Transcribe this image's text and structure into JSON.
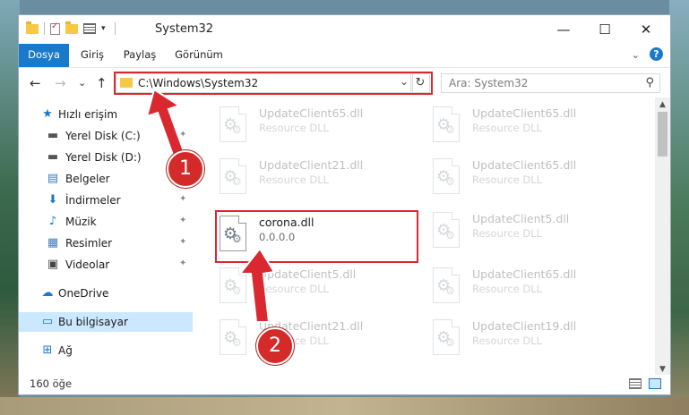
{
  "window": {
    "title": "System32",
    "min_glyph": "—",
    "max_glyph": "☐",
    "close_glyph": "✕"
  },
  "ribbon": {
    "tabs": [
      "Dosya",
      "Giriş",
      "Paylaş",
      "Görünüm"
    ],
    "expand_glyph": "⌄",
    "help_glyph": "?"
  },
  "nav": {
    "back_glyph": "←",
    "forward_glyph": "→",
    "recent_glyph": "⌄",
    "up_glyph": "↑",
    "address": "C:\\Windows\\System32",
    "address_drop_glyph": "⌄",
    "refresh_glyph": "↻",
    "search_placeholder": "Ara: System32",
    "search_glyph": "⚲"
  },
  "sidebar": {
    "items": [
      {
        "label": "Hızlı erişim",
        "icon": "star-icon",
        "glyph": "★",
        "color": "#1979ca"
      },
      {
        "label": "Yerel Disk (C:)",
        "icon": "drive-icon",
        "glyph": "▬",
        "color": "#555555"
      },
      {
        "label": "Yerel Disk (D:)",
        "icon": "drive-icon",
        "glyph": "▬",
        "color": "#555555"
      },
      {
        "label": "Belgeler",
        "icon": "document-icon",
        "glyph": "▤",
        "color": "#3d7ac2"
      },
      {
        "label": "İndirmeler",
        "icon": "download-icon",
        "glyph": "⬇",
        "color": "#1979ca"
      },
      {
        "label": "Müzik",
        "icon": "music-icon",
        "glyph": "♪",
        "color": "#1979ca"
      },
      {
        "label": "Resimler",
        "icon": "pictures-icon",
        "glyph": "▦",
        "color": "#3d7ac2"
      },
      {
        "label": "Videolar",
        "icon": "video-icon",
        "glyph": "▣",
        "color": "#444444"
      },
      {
        "label": "OneDrive",
        "icon": "cloud-icon",
        "glyph": "☁",
        "color": "#1979ca"
      },
      {
        "label": "Bu bilgisayar",
        "icon": "computer-icon",
        "glyph": "▭",
        "color": "#1979ca"
      },
      {
        "label": "Ağ",
        "icon": "network-icon",
        "glyph": "⊞",
        "color": "#1979ca"
      }
    ],
    "pin_glyph": "📌"
  },
  "files": [
    {
      "name": "UpdateClient65.dll",
      "sub": "Resource DLL"
    },
    {
      "name": "UpdateClient65.dll",
      "sub": "Resource DLL"
    },
    {
      "name": "UpdateClient21.dll",
      "sub": "Resource DLL"
    },
    {
      "name": "UpdateClient65.dll",
      "sub": "Resource DLL"
    },
    {
      "name": "corona.dll",
      "sub": "0.0.0.0",
      "sub2": "-"
    },
    {
      "name": "UpdateClient5.dll",
      "sub": "Resource DLL"
    },
    {
      "name": "UpdateClient5.dll",
      "sub": "Resource DLL"
    },
    {
      "name": "UpdateClient65.dll",
      "sub": "Resource DLL"
    },
    {
      "name": "UpdateClient21.dll",
      "sub": "Resource DLL"
    },
    {
      "name": "UpdateClient19.dll",
      "sub": "Resource DLL"
    }
  ],
  "status": {
    "item_count": "160 öğe"
  },
  "annotations": {
    "badge1": "1",
    "badge2": "2",
    "color": "#d9282f"
  }
}
